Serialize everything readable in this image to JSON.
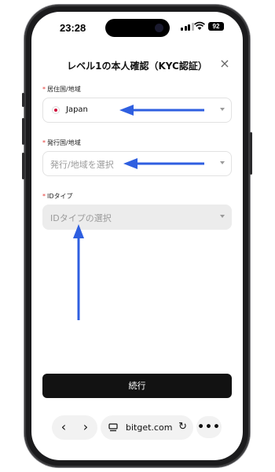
{
  "status_bar": {
    "time": "23:28",
    "battery": "92"
  },
  "header": {
    "title": "レベル1の本人確認（KYC認証）",
    "close_glyph": "×"
  },
  "form": {
    "residence": {
      "label": "居住国/地域",
      "value": "Japan",
      "flag_icon": "japan-flag-icon"
    },
    "issuing": {
      "label": "発行国/地域",
      "placeholder": "発行/地域を選択"
    },
    "id_type": {
      "label": "IDタイプ",
      "placeholder": "IDタイプの選択"
    },
    "required_mark": "*"
  },
  "continue_button": {
    "label": "続行"
  },
  "browser_bar": {
    "back_glyph": "‹",
    "forward_glyph": "›",
    "url": "bitget.com",
    "reload_glyph": "↻",
    "more_glyph": "•••"
  },
  "colors": {
    "arrow": "#2f5fe0",
    "button": "#121212",
    "required": "#e53935"
  }
}
